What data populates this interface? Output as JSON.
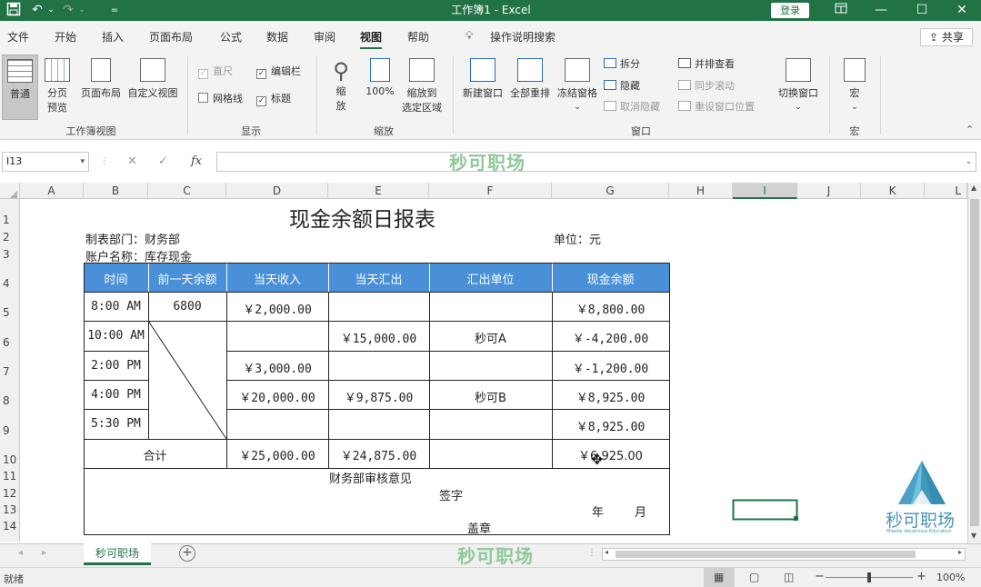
{
  "titlebar": {
    "title": "工作簿1  -  Excel",
    "login": "登录",
    "save_icon": "save-icon",
    "undo_icon": "undo-icon",
    "redo_icon": "redo-icon",
    "customize_icon": "customize-icon",
    "ribbon_display_icon": "ribbon-display-icon",
    "minimize": "—",
    "restore": "☐",
    "close": "✕"
  },
  "menu": {
    "tabs": [
      "文件",
      "开始",
      "插入",
      "页面布局",
      "公式",
      "数据",
      "审阅",
      "视图",
      "帮助"
    ],
    "active": "视图",
    "tell_me": "操作说明搜索",
    "share": "共享"
  },
  "ribbon": {
    "workbook_views": {
      "label": "工作簿视图",
      "normal": "普通",
      "page_break_1": "分页",
      "page_break_2": "预览",
      "page_layout": "页面布局",
      "custom_view": "自定义视图"
    },
    "show": {
      "label": "显示",
      "ruler": "直尺",
      "formula_bar": "编辑栏",
      "gridlines": "网格线",
      "headings": "标题"
    },
    "zoom": {
      "label": "缩放",
      "zoom_1": "缩",
      "zoom_2": "放",
      "zoom_100": "100%",
      "zoom_sel_1": "缩放到",
      "zoom_sel_2": "选定区域"
    },
    "window": {
      "label": "窗口",
      "new_window": "新建窗口",
      "arrange_all": "全部重排",
      "freeze_panes": "冻结窗格",
      "split": "拆分",
      "hide": "隐藏",
      "unhide": "取消隐藏",
      "side_by_side": "并排查看",
      "sync_scroll": "同步滚动",
      "reset_position": "重设窗口位置",
      "switch_windows": "切换窗口"
    },
    "macros": {
      "label": "宏",
      "macro": "宏"
    }
  },
  "formula_bar": {
    "name_box": "I13",
    "fx": "fx",
    "cancel": "✕",
    "enter": "✓",
    "value": ""
  },
  "watermark": "秒可职场",
  "sheet": {
    "columns": [
      "A",
      "B",
      "C",
      "D",
      "E",
      "F",
      "G",
      "H",
      "I",
      "J",
      "K",
      "L"
    ],
    "rows": [
      "1",
      "2",
      "3",
      "4",
      "5",
      "6",
      "7",
      "8",
      "9",
      "10",
      "11",
      "12",
      "13",
      "14"
    ],
    "title": "现金余额日报表",
    "dept": "制表部门：财务部",
    "unit": "单位：元",
    "account": "账户名称：库存现金",
    "headers": [
      "时间",
      "前一天余额",
      "当天收入",
      "当天汇出",
      "汇出单位",
      "现金余额"
    ],
    "data_rows": [
      [
        "8:00 AM",
        "6800",
        "￥2,000.00",
        "",
        "",
        "￥8,800.00"
      ],
      [
        "10:00 AM",
        "",
        "",
        "￥15,000.00",
        "秒可A",
        "￥-4,200.00"
      ],
      [
        "2:00 PM",
        "",
        "￥3,000.00",
        "",
        "",
        "￥-1,200.00"
      ],
      [
        "4:00 PM",
        "",
        "￥20,000.00",
        "￥9,875.00",
        "秒可B",
        "￥8,925.00"
      ],
      [
        "5:30 PM",
        "",
        "",
        "",
        "",
        "￥8,925.00"
      ]
    ],
    "total": [
      "合计",
      "￥25,000.00",
      "￥24,875.00",
      "",
      "￥6,925.00"
    ],
    "review_title": "财务部审核意见",
    "signature": "签字",
    "year": "年",
    "month": "月",
    "seal": "盖章",
    "logo_text": "秒可职场",
    "logo_sub": "Miaoke Vocational Education"
  },
  "tabs_bar": {
    "sheet_tab": "秒可职场",
    "add_sheet": "+"
  },
  "status": {
    "ready": "就绪",
    "zoom": "100%"
  },
  "colors": {
    "excel_green": "#217346",
    "header_blue": "#4a90d9",
    "watermark_green": "#8fc89a"
  }
}
